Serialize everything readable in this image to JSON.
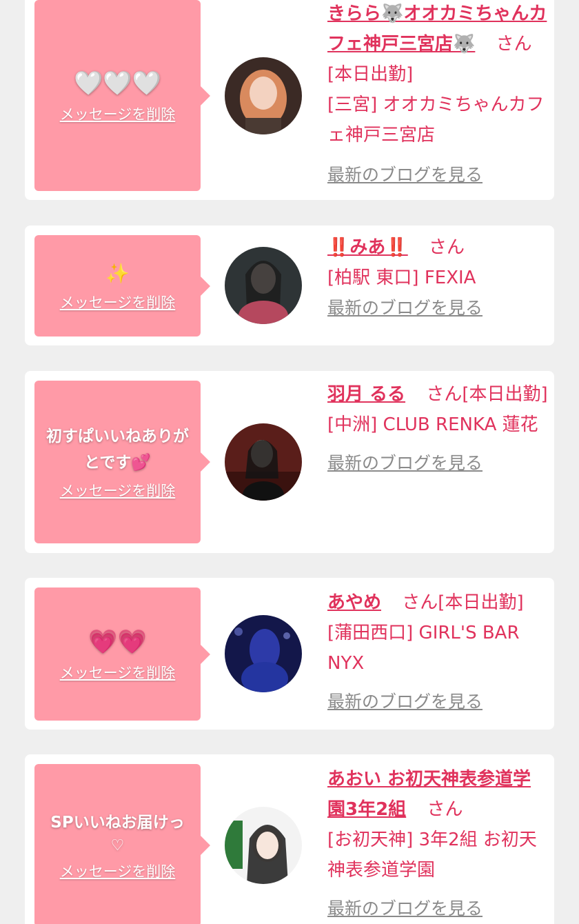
{
  "messages": [
    {
      "message_text": "🤍🤍🤍",
      "delete_label": "メッセージを削除",
      "cast_name": "きらら🐺オオカミちゃんカフェ神戸三宮店🐺",
      "honorific": "さん",
      "attendance": "[本日出勤]",
      "shop": "[三宮] オオカミちゃんカフェ神戸三宮店",
      "blog_label": "最新のブログを見る"
    },
    {
      "message_text": "✨",
      "delete_label": "メッセージを削除",
      "cast_name": "‼️みあ‼️",
      "honorific": "さん",
      "attendance": "",
      "shop": "[柏駅 東口] FEXIA",
      "blog_label": "最新のブログを見る"
    },
    {
      "message_text": "初すぱいいねありがとです💕",
      "delete_label": "メッセージを削除",
      "cast_name": "羽月 るる",
      "honorific": "さん",
      "attendance": "[本日出勤]",
      "shop": "[中洲] CLUB RENKA 蓮花",
      "blog_label": "最新のブログを見る"
    },
    {
      "message_text": "💗💗",
      "delete_label": "メッセージを削除",
      "cast_name": "あやめ",
      "honorific": "さん",
      "attendance": "[本日出勤]",
      "shop": "[蒲田西口] GIRL'S BAR NYX",
      "blog_label": "最新のブログを見る"
    },
    {
      "message_text": "SPいいねお届けっ",
      "message_sub": "♡",
      "delete_label": "メッセージを削除",
      "cast_name": "あおい お初天神表参道学園3年2組",
      "honorific": "さん",
      "attendance": "",
      "shop": "[お初天神] 3年2組 お初天神表参道学園",
      "blog_label": "最新のブログを見る"
    }
  ],
  "colors": {
    "page_bg": "#efefef",
    "card_bg": "#ffffff",
    "bubble": "#ff9aa7",
    "accent": "#e0325c",
    "link_gray": "#8a8a8a"
  }
}
